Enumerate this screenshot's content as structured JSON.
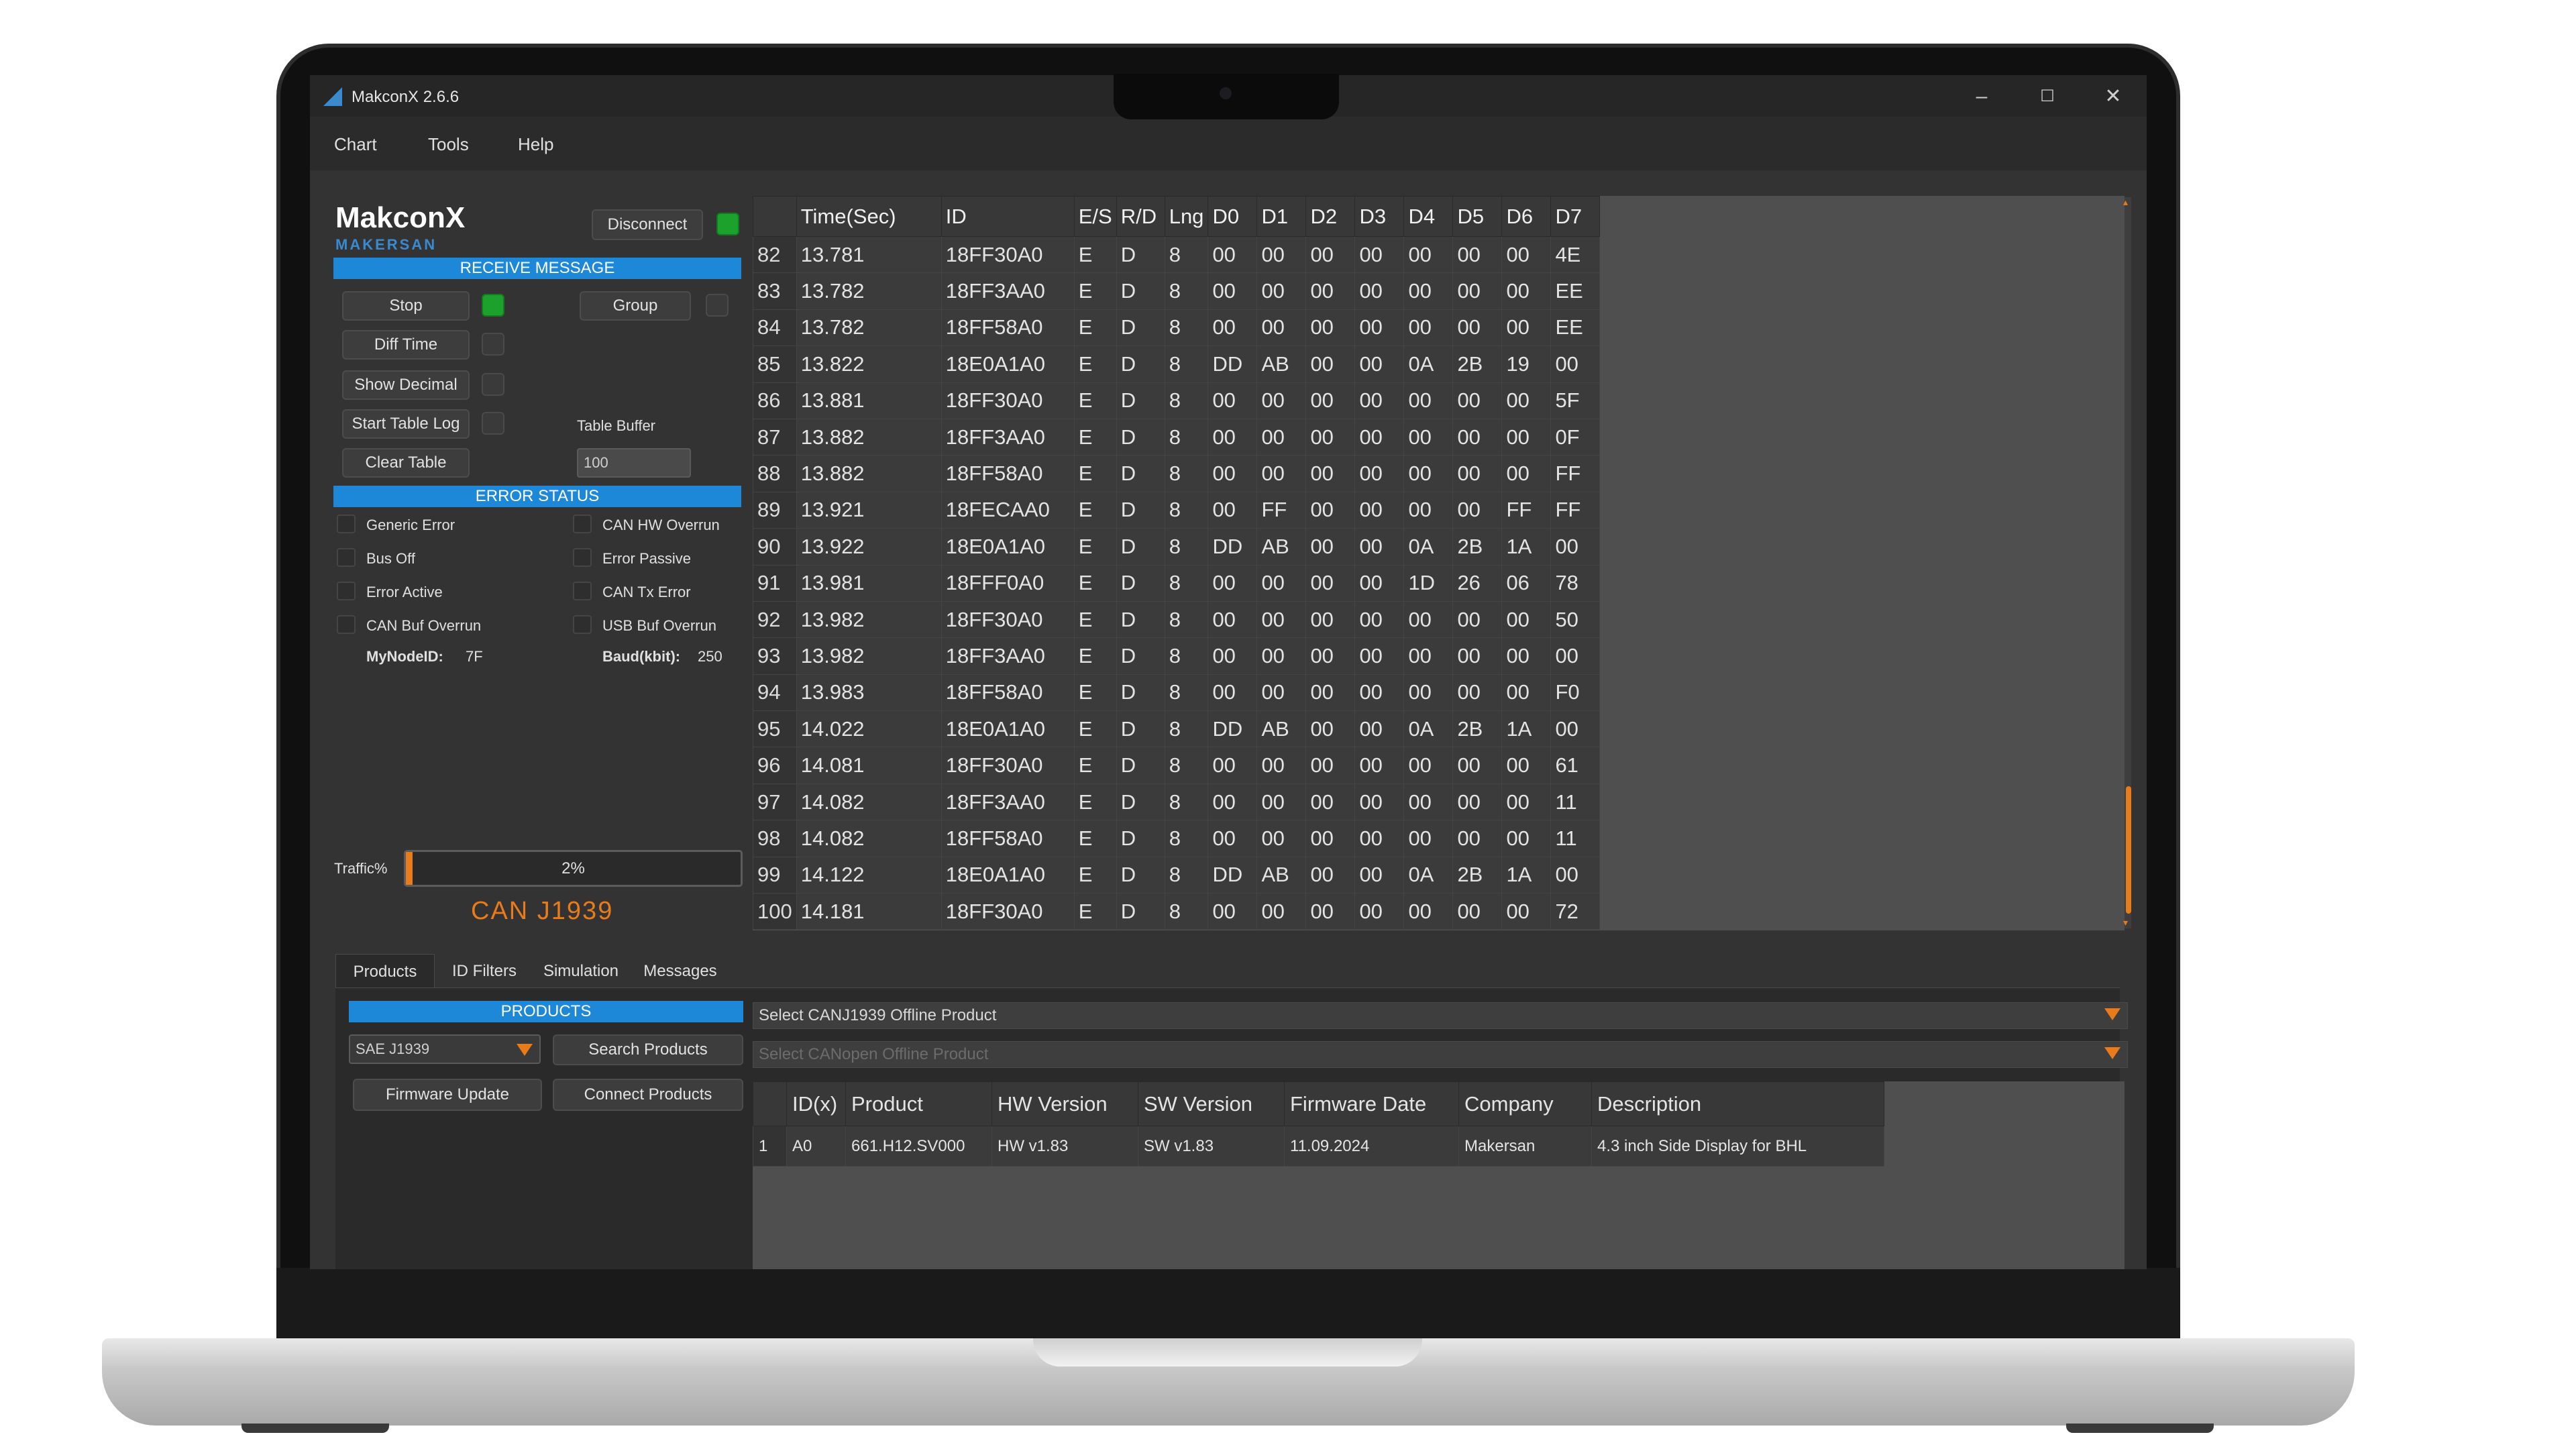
{
  "window": {
    "title": "MakconX 2.6.6"
  },
  "menu": [
    "Chart",
    "Tools",
    "Help"
  ],
  "brand": {
    "name": "MakconX",
    "sub": "MAKERSAN"
  },
  "controls": {
    "disconnect": "Disconnect",
    "receive_title": "RECEIVE MESSAGE",
    "stop": "Stop",
    "group": "Group",
    "diff_time": "Diff Time",
    "show_decimal": "Show Decimal",
    "start_table_log": "Start Table Log",
    "table_buffer_label": "Table Buffer",
    "clear_table": "Clear Table",
    "table_buffer_value": "100"
  },
  "error_status": {
    "title": "ERROR STATUS",
    "items_left": [
      "Generic Error",
      "Bus Off",
      "Error Active",
      "CAN Buf Overrun"
    ],
    "items_right": [
      "CAN HW Overrun",
      "Error Passive",
      "CAN Tx Error",
      "USB Buf Overrun"
    ],
    "node_label": "MyNodeID:",
    "node_value": "7F",
    "baud_label": "Baud(kbit):",
    "baud_value": "250"
  },
  "traffic": {
    "label": "Traffic%",
    "value": "2%",
    "fraction": 0.02
  },
  "protocol": "CAN  J1939",
  "messages": {
    "columns": [
      "",
      "Time(Sec)",
      "ID",
      "E/S",
      "R/D",
      "Lng",
      "D0",
      "D1",
      "D2",
      "D3",
      "D4",
      "D5",
      "D6",
      "D7"
    ],
    "rows": [
      [
        "82",
        "13.781",
        "18FF30A0",
        "E",
        "D",
        "8",
        "00",
        "00",
        "00",
        "00",
        "00",
        "00",
        "00",
        "4E"
      ],
      [
        "83",
        "13.782",
        "18FF3AA0",
        "E",
        "D",
        "8",
        "00",
        "00",
        "00",
        "00",
        "00",
        "00",
        "00",
        "EE"
      ],
      [
        "84",
        "13.782",
        "18FF58A0",
        "E",
        "D",
        "8",
        "00",
        "00",
        "00",
        "00",
        "00",
        "00",
        "00",
        "EE"
      ],
      [
        "85",
        "13.822",
        "18E0A1A0",
        "E",
        "D",
        "8",
        "DD",
        "AB",
        "00",
        "00",
        "0A",
        "2B",
        "19",
        "00"
      ],
      [
        "86",
        "13.881",
        "18FF30A0",
        "E",
        "D",
        "8",
        "00",
        "00",
        "00",
        "00",
        "00",
        "00",
        "00",
        "5F"
      ],
      [
        "87",
        "13.882",
        "18FF3AA0",
        "E",
        "D",
        "8",
        "00",
        "00",
        "00",
        "00",
        "00",
        "00",
        "00",
        "0F"
      ],
      [
        "88",
        "13.882",
        "18FF58A0",
        "E",
        "D",
        "8",
        "00",
        "00",
        "00",
        "00",
        "00",
        "00",
        "00",
        "FF"
      ],
      [
        "89",
        "13.921",
        "18FECAA0",
        "E",
        "D",
        "8",
        "00",
        "FF",
        "00",
        "00",
        "00",
        "00",
        "FF",
        "FF"
      ],
      [
        "90",
        "13.922",
        "18E0A1A0",
        "E",
        "D",
        "8",
        "DD",
        "AB",
        "00",
        "00",
        "0A",
        "2B",
        "1A",
        "00"
      ],
      [
        "91",
        "13.981",
        "18FFF0A0",
        "E",
        "D",
        "8",
        "00",
        "00",
        "00",
        "00",
        "1D",
        "26",
        "06",
        "78"
      ],
      [
        "92",
        "13.982",
        "18FF30A0",
        "E",
        "D",
        "8",
        "00",
        "00",
        "00",
        "00",
        "00",
        "00",
        "00",
        "50"
      ],
      [
        "93",
        "13.982",
        "18FF3AA0",
        "E",
        "D",
        "8",
        "00",
        "00",
        "00",
        "00",
        "00",
        "00",
        "00",
        "00"
      ],
      [
        "94",
        "13.983",
        "18FF58A0",
        "E",
        "D",
        "8",
        "00",
        "00",
        "00",
        "00",
        "00",
        "00",
        "00",
        "F0"
      ],
      [
        "95",
        "14.022",
        "18E0A1A0",
        "E",
        "D",
        "8",
        "DD",
        "AB",
        "00",
        "00",
        "0A",
        "2B",
        "1A",
        "00"
      ],
      [
        "96",
        "14.081",
        "18FF30A0",
        "E",
        "D",
        "8",
        "00",
        "00",
        "00",
        "00",
        "00",
        "00",
        "00",
        "61"
      ],
      [
        "97",
        "14.082",
        "18FF3AA0",
        "E",
        "D",
        "8",
        "00",
        "00",
        "00",
        "00",
        "00",
        "00",
        "00",
        "11"
      ],
      [
        "98",
        "14.082",
        "18FF58A0",
        "E",
        "D",
        "8",
        "00",
        "00",
        "00",
        "00",
        "00",
        "00",
        "00",
        "11"
      ],
      [
        "99",
        "14.122",
        "18E0A1A0",
        "E",
        "D",
        "8",
        "DD",
        "AB",
        "00",
        "00",
        "0A",
        "2B",
        "1A",
        "00"
      ],
      [
        "100",
        "14.181",
        "18FF30A0",
        "E",
        "D",
        "8",
        "00",
        "00",
        "00",
        "00",
        "00",
        "00",
        "00",
        "72"
      ]
    ]
  },
  "tabs": [
    "Products",
    "ID Filters",
    "Simulation",
    "Messages"
  ],
  "products": {
    "title": "PRODUCTS",
    "protocol_select": "SAE J1939",
    "search": "Search Products",
    "firmware_update": "Firmware Update",
    "connect": "Connect Products",
    "select_j1939": "Select CANJ1939 Offline Product",
    "select_canopen": "Select CANopen Offline Product",
    "columns": [
      "",
      "ID(x)",
      "Product",
      "HW Version",
      "SW Version",
      "Firmware Date",
      "Company",
      "Description"
    ],
    "rows": [
      [
        "1",
        "A0",
        "661.H12.SV000",
        "HW v1.83",
        "SW v1.83",
        "11.09.2024",
        "Makersan",
        "4.3 inch Side Display for BHL"
      ]
    ]
  },
  "colors": {
    "accent": "#1e88d8",
    "orange": "#e87b1a",
    "led_on": "#1ca22c"
  }
}
